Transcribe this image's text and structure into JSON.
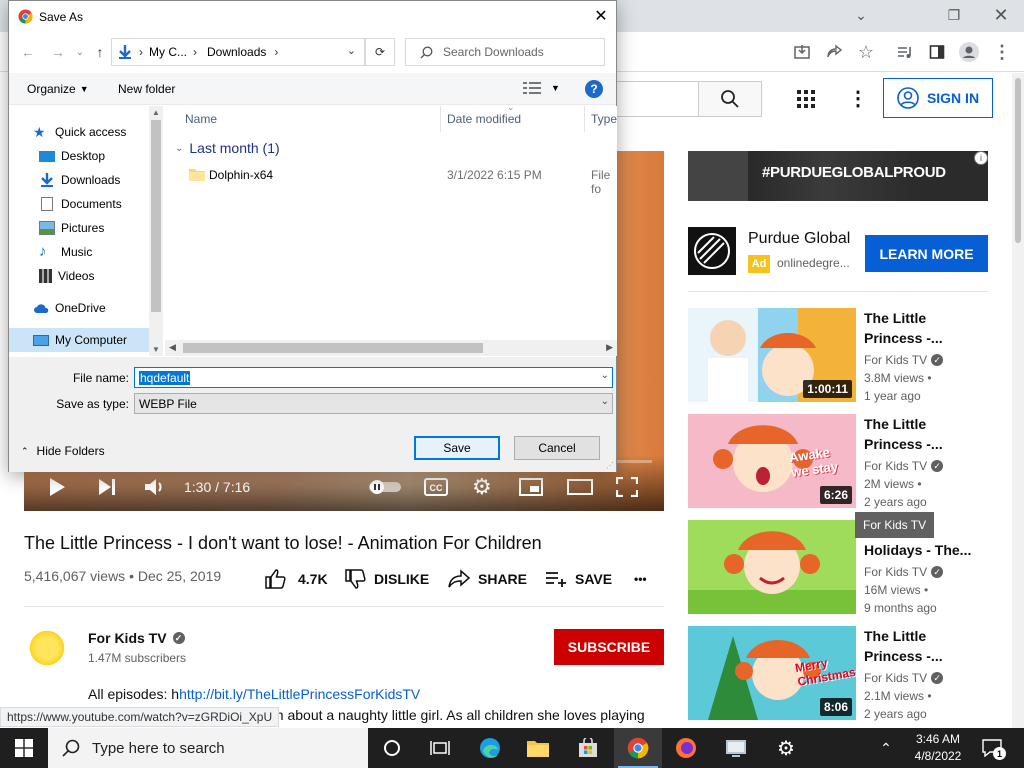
{
  "browser": {
    "search_icon": "search-icon",
    "signin_label": "SIGN IN"
  },
  "video": {
    "time": "1:30 / 7:16",
    "progress": 0.21,
    "title": "The Little Princess - I don't want to lose! - Animation For Children",
    "meta": "5,416,067 views • Dec 25, 2019",
    "likes": "4.7K",
    "dislike_label": "DISLIKE",
    "share_label": "SHARE",
    "save_label": "SAVE",
    "more_label": "•••"
  },
  "channel": {
    "name": "For Kids TV",
    "subscribers": "1.47M subscribers",
    "subscribe_label": "SUBSCRIBE",
    "desc_prefix": "All episodes: h",
    "desc_link": "http://bit.ly/TheLittlePrincessForKidsTV",
    "desc_line2": "on about a naughty little girl. As all children she loves playing",
    "status_url": "https://www.youtube.com/watch?v=zGRDiOi_XpU"
  },
  "ad": {
    "banner_text": "#PURDUEGLOBALPROUD",
    "info": "i",
    "title": "Purdue Global",
    "badge": "Ad",
    "domain": "onlinedegre...",
    "cta": "LEARN MORE"
  },
  "recommendations": [
    {
      "title": "The Little Princess -...",
      "channel": "For Kids TV",
      "views": "3.8M views •",
      "age": "1 year ago",
      "duration": "1:00:11"
    },
    {
      "title": "The Little Princess -...",
      "channel": "For Kids TV",
      "views": "2M views •",
      "age": "2 years ago",
      "duration": "6:26",
      "thumb_text": "Awake we stay"
    },
    {
      "title": "...mmer Holidays - The...",
      "channel": "For Kids TV",
      "views": "16M views •",
      "age": "9 months ago",
      "duration": ""
    },
    {
      "title": "The Little Princess -...",
      "channel": "For Kids TV",
      "views": "2.1M views •",
      "age": "2 years ago",
      "duration": "8:06",
      "thumb_text": "Merry Christmas!"
    }
  ],
  "tooltip": "For Kids TV",
  "dialog": {
    "title": "Save As",
    "breadcrumb": [
      "My C...",
      "Downloads"
    ],
    "search_placeholder": "Search Downloads",
    "organize_label": "Organize",
    "new_folder_label": "New folder",
    "help": "?",
    "nav_items": [
      {
        "label": "Quick access",
        "icon": "star-icon"
      },
      {
        "label": "Desktop",
        "icon": "desktop-icon"
      },
      {
        "label": "Downloads",
        "icon": "download-icon"
      },
      {
        "label": "Documents",
        "icon": "document-icon"
      },
      {
        "label": "Pictures",
        "icon": "pictures-icon"
      },
      {
        "label": "Music",
        "icon": "music-icon"
      },
      {
        "label": "Videos",
        "icon": "video-icon"
      },
      {
        "label": "OneDrive",
        "icon": "cloud-icon"
      },
      {
        "label": "My Computer",
        "icon": "computer-icon"
      }
    ],
    "columns": {
      "name": "Name",
      "date": "Date modified",
      "type": "Type"
    },
    "group_label": "Last month (1)",
    "files": [
      {
        "name": "Dolphin-x64",
        "date": "3/1/2022 6:15 PM",
        "type": "File fo"
      }
    ],
    "file_name_label": "File name:",
    "file_name_value": "hqdefault",
    "save_as_type_label": "Save as type:",
    "save_as_type_value": "WEBP File",
    "hide_folders_label": "Hide Folders",
    "save_button": "Save",
    "cancel_button": "Cancel"
  },
  "taskbar": {
    "search_placeholder": "Type here to search",
    "time": "3:46 AM",
    "date": "4/8/2022",
    "notification_count": "1"
  },
  "colors": {
    "youtube_red": "#cc0000",
    "youtube_blue": "#065fd4",
    "windows_accent": "#0078d7",
    "taskbar": "#1f1f1f"
  }
}
